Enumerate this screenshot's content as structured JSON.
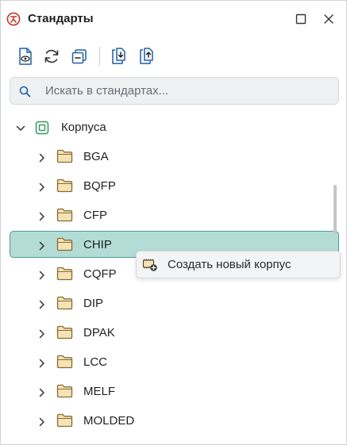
{
  "window": {
    "title": "Стандарты",
    "app_icon": "standards-logo-icon",
    "controls": [
      "maximize-icon",
      "close-icon"
    ]
  },
  "toolbar": {
    "buttons": [
      "view-document-icon",
      "refresh-icon",
      "collapse-all-icon",
      "import-icon",
      "export-icon"
    ]
  },
  "search": {
    "placeholder": "Искать в стандартах...",
    "value": ""
  },
  "tree": {
    "root": {
      "label": "Корпуса",
      "icon": "chip-package-icon",
      "expanded": true
    },
    "items": [
      {
        "label": "BGA",
        "selected": false
      },
      {
        "label": "BQFP",
        "selected": false
      },
      {
        "label": "CFP",
        "selected": false
      },
      {
        "label": "CHIP",
        "selected": true
      },
      {
        "label": "CQFP",
        "selected": false
      },
      {
        "label": "DIP",
        "selected": false
      },
      {
        "label": "DPAK",
        "selected": false
      },
      {
        "label": "LCC",
        "selected": false
      },
      {
        "label": "MELF",
        "selected": false
      },
      {
        "label": "MOLDED",
        "selected": false
      }
    ]
  },
  "context_menu": {
    "items": [
      {
        "label": "Создать новый корпус",
        "icon": "create-package-icon"
      }
    ]
  },
  "colors": {
    "accent": "#c0392b",
    "selection_bg": "#b3dcd7",
    "selection_border": "#4f9e93",
    "folder_fill": "#f5e3b8",
    "folder_stroke": "#8a6a2e",
    "chip_icon": "#2e9a5a",
    "toolbar_icon": "#1f5fa8"
  }
}
